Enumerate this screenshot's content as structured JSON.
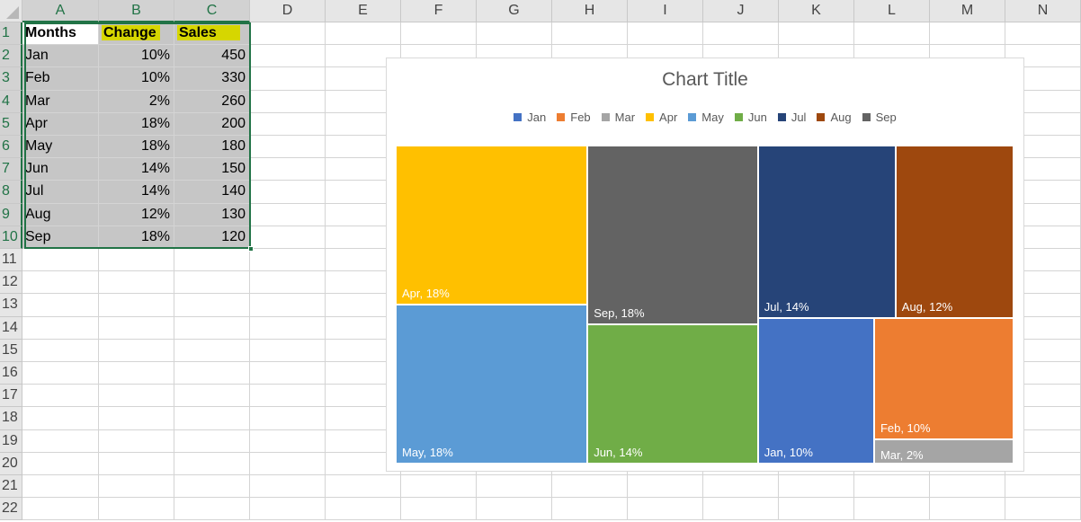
{
  "spreadsheet": {
    "columns": [
      "A",
      "B",
      "C",
      "D",
      "E",
      "F",
      "G",
      "H",
      "I",
      "J",
      "K",
      "L",
      "M",
      "N"
    ],
    "rows": [
      "1",
      "2",
      "3",
      "4",
      "5",
      "6",
      "7",
      "8",
      "9",
      "10",
      "11",
      "12",
      "13",
      "14",
      "15",
      "16",
      "17",
      "18",
      "19",
      "20",
      "21",
      "22"
    ],
    "header": {
      "months": "Months",
      "change": "Change",
      "sales": "Sales"
    },
    "data": [
      {
        "month": "Jan",
        "change": "10%",
        "sales": "450"
      },
      {
        "month": "Feb",
        "change": "10%",
        "sales": "330"
      },
      {
        "month": "Mar",
        "change": "2%",
        "sales": "260"
      },
      {
        "month": "Apr",
        "change": "18%",
        "sales": "200"
      },
      {
        "month": "May",
        "change": "18%",
        "sales": "180"
      },
      {
        "month": "Jun",
        "change": "14%",
        "sales": "150"
      },
      {
        "month": "Jul",
        "change": "14%",
        "sales": "140"
      },
      {
        "month": "Aug",
        "change": "12%",
        "sales": "130"
      },
      {
        "month": "Sep",
        "change": "18%",
        "sales": "120"
      }
    ],
    "colors": {
      "selection": "#217346",
      "highlight": "#d6d600"
    }
  },
  "chart_data": {
    "type": "treemap",
    "title": "Chart Title",
    "legend_position": "top",
    "series": [
      {
        "name": "Jan",
        "color": "#4472c4"
      },
      {
        "name": "Feb",
        "color": "#ed7d31"
      },
      {
        "name": "Mar",
        "color": "#a5a5a5"
      },
      {
        "name": "Apr",
        "color": "#ffc000"
      },
      {
        "name": "May",
        "color": "#5b9bd5"
      },
      {
        "name": "Jun",
        "color": "#70ad47"
      },
      {
        "name": "Jul",
        "color": "#264478"
      },
      {
        "name": "Aug",
        "color": "#9e480e"
      },
      {
        "name": "Sep",
        "color": "#636363"
      }
    ],
    "tiles": [
      {
        "name": "Apr",
        "value": 18,
        "label": "Apr, 18%"
      },
      {
        "name": "May",
        "value": 18,
        "label": "May, 18%"
      },
      {
        "name": "Sep",
        "value": 18,
        "label": "Sep, 18%"
      },
      {
        "name": "Jun",
        "value": 14,
        "label": "Jun, 14%"
      },
      {
        "name": "Jul",
        "value": 14,
        "label": "Jul, 14%"
      },
      {
        "name": "Aug",
        "value": 12,
        "label": "Aug, 12%"
      },
      {
        "name": "Jan",
        "value": 10,
        "label": "Jan, 10%"
      },
      {
        "name": "Feb",
        "value": 10,
        "label": "Feb, 10%"
      },
      {
        "name": "Mar",
        "value": 2,
        "label": "Mar, 2%"
      }
    ]
  }
}
